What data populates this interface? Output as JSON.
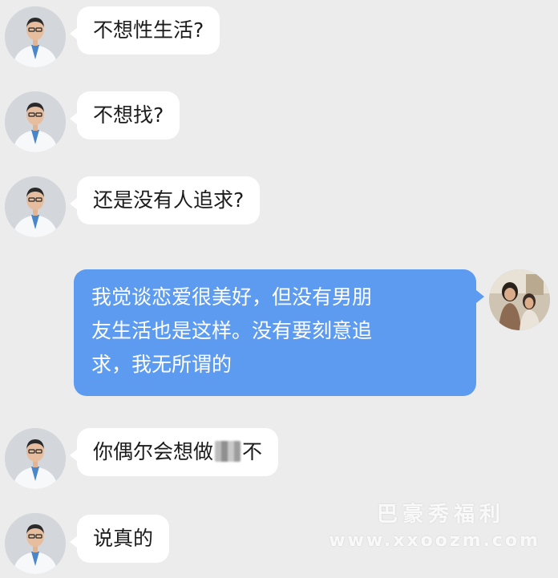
{
  "messages": [
    {
      "text": "不想性生活?"
    },
    {
      "text": "不想找?"
    },
    {
      "text": "还是没有人追求?"
    },
    {
      "lines": [
        "我觉谈恋爱很美好，但没有男朋",
        "友生活也是这样。没有要刻意追",
        "求，我无所谓的"
      ]
    },
    {
      "before": "你偶尔会想做",
      "after": "不"
    },
    {
      "text": "说真的"
    }
  ],
  "watermark": {
    "line1": "巴豪秀福利",
    "line2": "www.xxoozm.com"
  },
  "colors": {
    "background": "#ececec",
    "incoming_bubble": "#ffffff",
    "outgoing_bubble": "#5d9bf0"
  }
}
